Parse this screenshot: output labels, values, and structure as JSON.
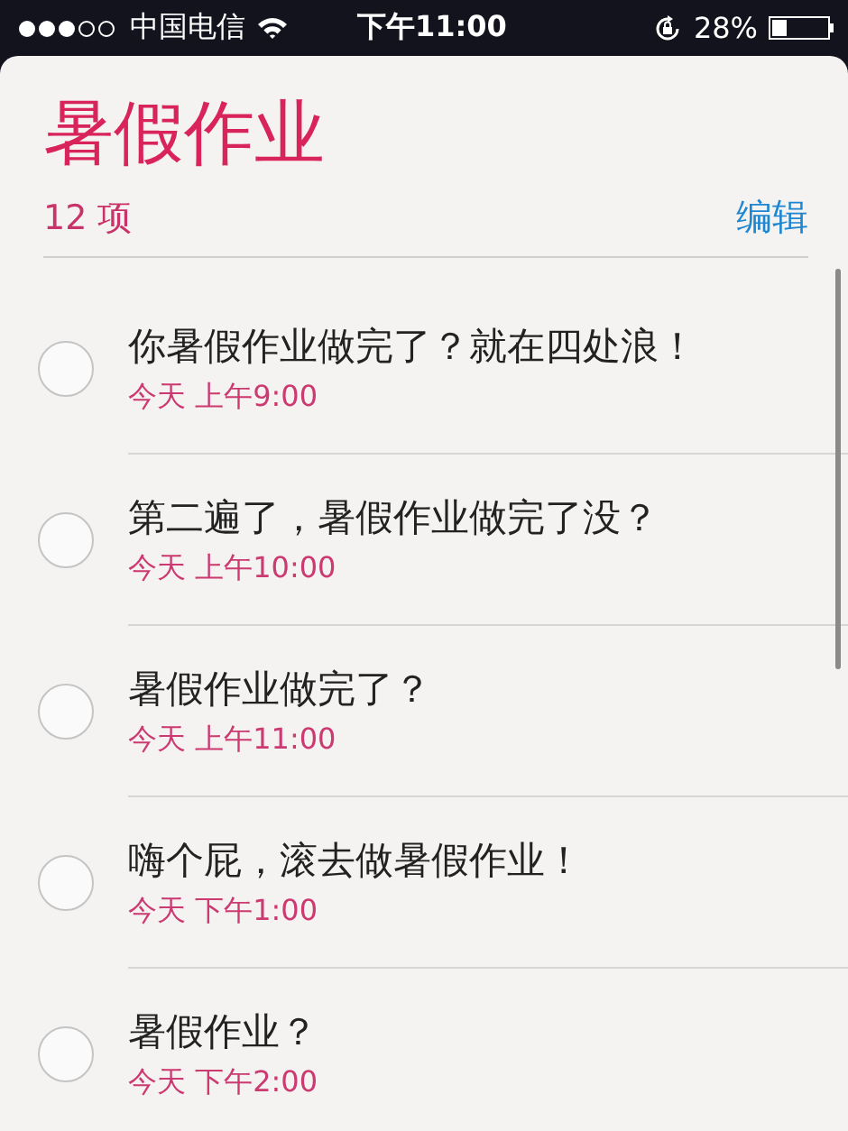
{
  "status_bar": {
    "carrier": "中国电信",
    "time": "下午11:00",
    "battery_percent": "28%",
    "battery": {
      "level": 0.28
    }
  },
  "list": {
    "title": "暑假作业",
    "count": "12 项",
    "edit": "编辑"
  },
  "reminders": [
    {
      "title": "你暑假作业做完了？就在四处浪！",
      "due": "今天 上午9:00",
      "checked": false
    },
    {
      "title": "第二遍了，暑假作业做完了没？",
      "due": "今天 上午10:00",
      "checked": false
    },
    {
      "title": "暑假作业做完了？",
      "due": "今天 上午11:00",
      "checked": false
    },
    {
      "title": "嗨个屁，滚去做暑假作业！",
      "due": "今天 下午1:00",
      "checked": false
    },
    {
      "title": "暑假作业？",
      "due": "今天 下午2:00",
      "checked": false
    }
  ]
}
